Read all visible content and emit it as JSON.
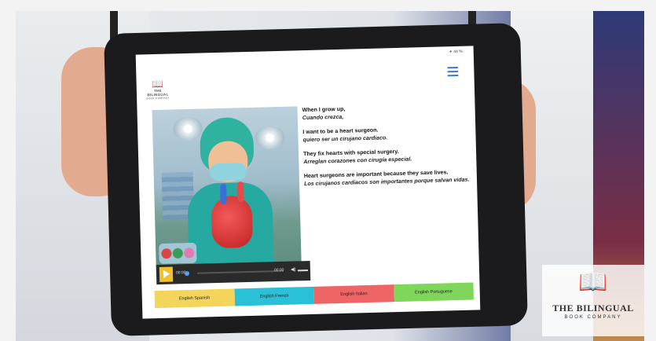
{
  "status_bar": {
    "text": "✈ 44 %"
  },
  "brand": {
    "name_line1": "THE BILINGUAL",
    "name_line2": "BOOK COMPANY"
  },
  "story": {
    "lines": [
      {
        "en": "When I grow up,",
        "es": "Cuando crezca,"
      },
      {
        "en": "I want to be a heart surgeon.",
        "es": "quiero ser un cirujano cardiaco."
      },
      {
        "en": "They fix hearts with special surgery.",
        "es": "Arreglan corazones con cirugía especial."
      },
      {
        "en": "Heart surgeons are important because they save lives.",
        "es": "Los cirujanos cardiacos son importantes porque salvan vidas."
      }
    ]
  },
  "player": {
    "current_time": "00:00",
    "duration": "00:00",
    "progress": 0
  },
  "languages": [
    {
      "label": "English Spanish",
      "color": "#f4d55b"
    },
    {
      "label": "English French",
      "color": "#29c0d8"
    },
    {
      "label": "English Italian",
      "color": "#ef6464"
    },
    {
      "label": "English Portuguese",
      "color": "#7fd65b"
    }
  ],
  "icons": {
    "menu": "hamburger-menu-icon",
    "play": "play-icon",
    "volume": "volume-icon",
    "logo": "open-book-icon"
  }
}
